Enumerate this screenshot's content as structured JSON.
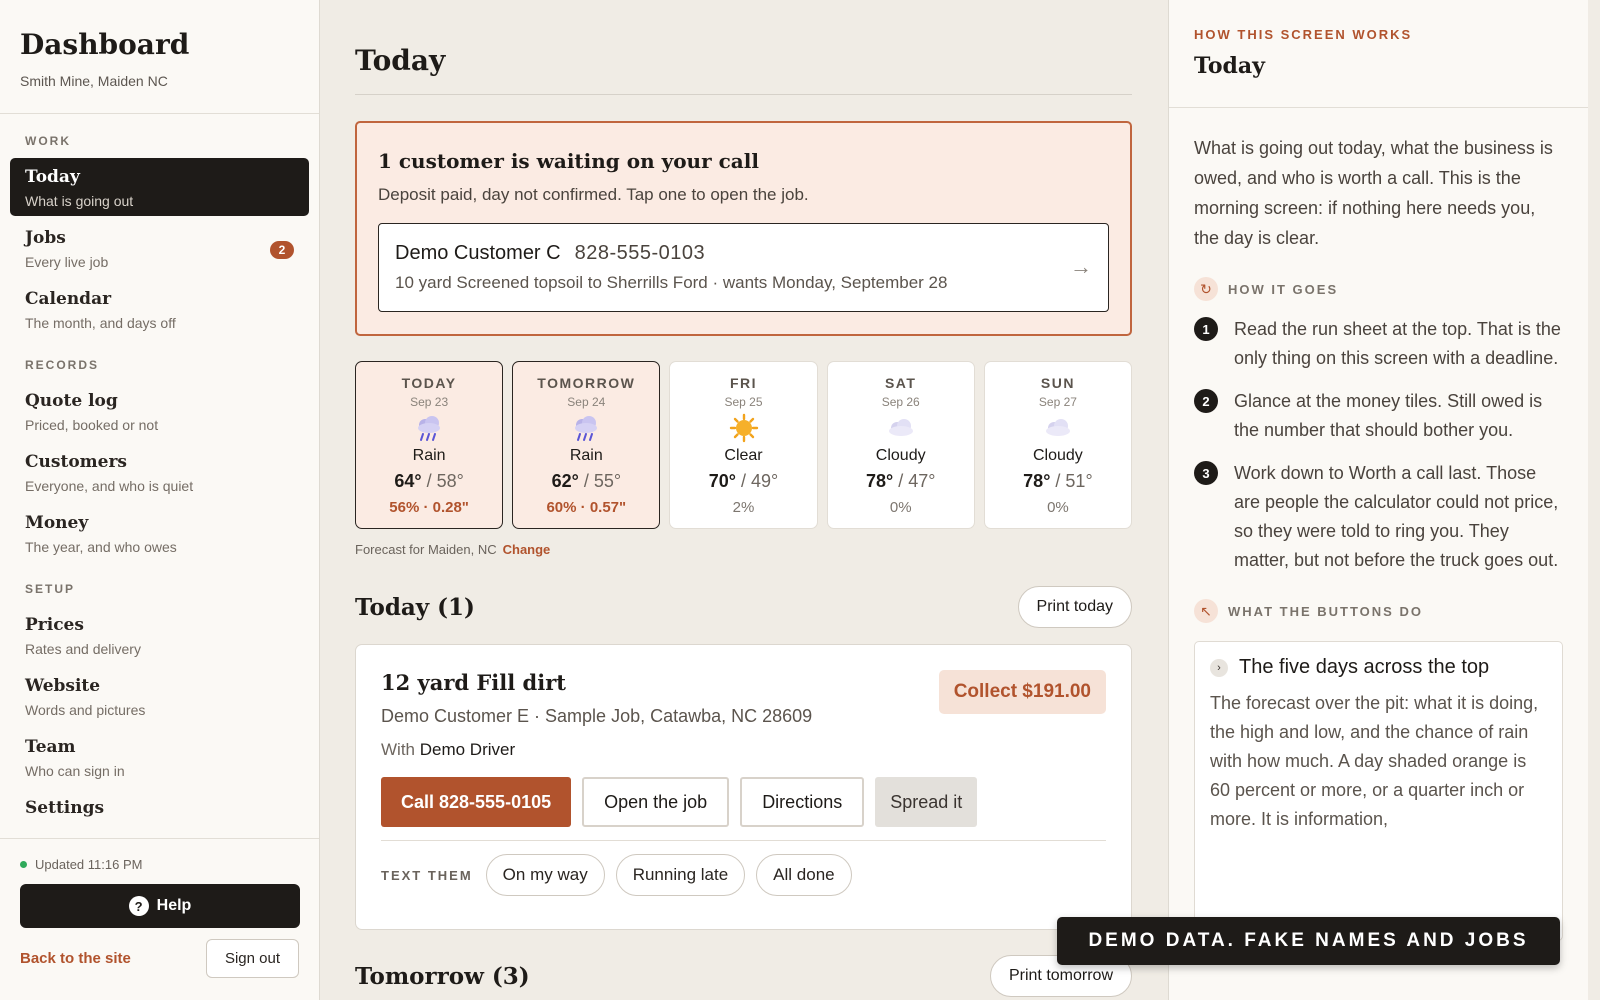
{
  "sidebar": {
    "title": "Dashboard",
    "subtitle": "Smith Mine, Maiden NC",
    "sections": [
      {
        "label": "WORK",
        "items": [
          {
            "label": "Today",
            "sub": "What is going out",
            "active": true
          },
          {
            "label": "Jobs",
            "sub": "Every live job",
            "badge": "2"
          },
          {
            "label": "Calendar",
            "sub": "The month, and days off"
          }
        ]
      },
      {
        "label": "RECORDS",
        "items": [
          {
            "label": "Quote log",
            "sub": "Priced, booked or not"
          },
          {
            "label": "Customers",
            "sub": "Everyone, and who is quiet"
          },
          {
            "label": "Money",
            "sub": "The year, and who owes"
          }
        ]
      },
      {
        "label": "SETUP",
        "items": [
          {
            "label": "Prices",
            "sub": "Rates and delivery"
          },
          {
            "label": "Website",
            "sub": "Words and pictures"
          },
          {
            "label": "Team",
            "sub": "Who can sign in"
          },
          {
            "label": "Settings",
            "sub": ""
          }
        ]
      }
    ],
    "updated": "Updated 11:16 PM",
    "help_label": "Help",
    "help_icon": "?",
    "back_label": "Back to the site",
    "signout_label": "Sign out"
  },
  "main": {
    "title": "Today",
    "alert": {
      "title": "1 customer is waiting on your call",
      "subtitle": "Deposit paid, day not confirmed. Tap one to open the job.",
      "customer": "Demo Customer C",
      "phone": "828-555-0103",
      "detail": "10 yard Screened topsoil to Sherrills Ford · wants Monday, September 28",
      "arrow": "→"
    },
    "forecast": [
      {
        "day": "TODAY",
        "date": "Sep 23",
        "icon": "rain-cloud-icon",
        "cond": "Rain",
        "hi": "64°",
        "lo": "/ 58°",
        "rain": "56% · 0.28\"",
        "wet": true
      },
      {
        "day": "TOMORROW",
        "date": "Sep 24",
        "icon": "rain-cloud-icon",
        "cond": "Rain",
        "hi": "62°",
        "lo": "/ 55°",
        "rain": "60% · 0.57\"",
        "wet": true
      },
      {
        "day": "FRI",
        "date": "Sep 25",
        "icon": "sun-icon",
        "cond": "Clear",
        "hi": "70°",
        "lo": "/ 49°",
        "rain": "2%",
        "wet": false
      },
      {
        "day": "SAT",
        "date": "Sep 26",
        "icon": "cloud-icon",
        "cond": "Cloudy",
        "hi": "78°",
        "lo": "/ 47°",
        "rain": "0%",
        "wet": false
      },
      {
        "day": "SUN",
        "date": "Sep 27",
        "icon": "cloud-icon",
        "cond": "Cloudy",
        "hi": "78°",
        "lo": "/ 51°",
        "rain": "0%",
        "wet": false
      }
    ],
    "forecast_note": "Forecast for Maiden, NC",
    "forecast_change": "Change",
    "today_section": {
      "title": "Today (1)",
      "print_label": "Print today"
    },
    "job": {
      "title": "12 yard Fill dirt",
      "address": "Demo Customer E · Sample Job, Catawba, NC 28609",
      "with_prefix": "With",
      "driver": "Demo Driver",
      "collect": "Collect $191.00",
      "call_label": "Call 828-555-0105",
      "open_label": "Open the job",
      "directions_label": "Directions",
      "spread_label": "Spread it",
      "text_them_label": "TEXT THEM",
      "chips": [
        "On my way",
        "Running late",
        "All done"
      ]
    },
    "tomorrow_section": {
      "title": "Tomorrow (3)",
      "print_label": "Print tomorrow"
    }
  },
  "right": {
    "eyebrow": "HOW THIS SCREEN WORKS",
    "title": "Today",
    "intro": "What is going out today, what the business is owed, and who is worth a call. This is the morning screen: if nothing here needs you, the day is clear.",
    "how_label": "HOW IT GOES",
    "how_icon": "↻",
    "steps": [
      {
        "n": "1",
        "text": "Read the run sheet at the top. That is the only thing on this screen with a deadline."
      },
      {
        "n": "2",
        "text": "Glance at the money tiles. Still owed is the number that should bother you."
      },
      {
        "n": "3",
        "text": "Work down to Worth a call last. Those are people the calculator could not price, so they were told to ring you. They matter, but not before the truck goes out."
      }
    ],
    "buttons_label": "WHAT THE BUTTONS DO",
    "buttons_icon": "↖",
    "accordion": {
      "chevron": "›",
      "title": "The five days across the top",
      "text": "The forecast over the pit: what it is doing, the high and low, and the chance of rain with how much. A day shaded orange is 60 percent or more, or a quarter inch or more. It is information,"
    }
  },
  "banner": "DEMO DATA. FAKE NAMES AND JOBS",
  "colors": {
    "accent": "#b1532d",
    "dark": "#1e1b18",
    "alert_bg": "#fbebe3",
    "status_green": "#2faa5a"
  }
}
